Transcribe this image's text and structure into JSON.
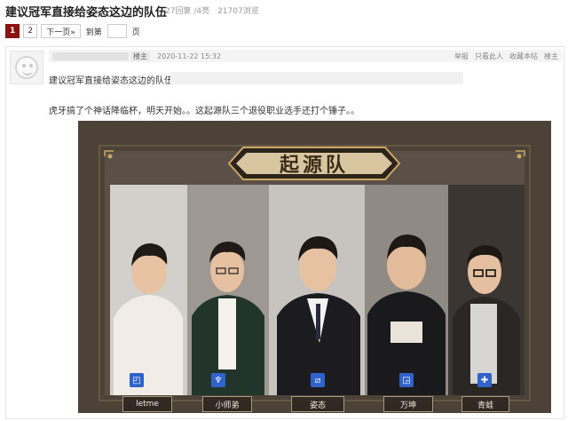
{
  "thread": {
    "title": "建议冠军直接给姿态这边的队伍",
    "stats": "27回复 /4亮　21707浏览"
  },
  "pager": {
    "pages": [
      "1",
      "2"
    ],
    "next_label": "下一页»",
    "goto_label": "到第",
    "page_unit": "页"
  },
  "post": {
    "floor": "楼主",
    "date": "2020-11-22 15:32",
    "actions": [
      "举报",
      "只看此人",
      "收藏本帖",
      "楼主"
    ],
    "title": "建议冠军直接给姿态这边的队伍",
    "body": "虎牙搞了个神话降临杯，明天开始。。这起源队三个退役职业选手还打个锤子。。"
  },
  "banner": {
    "team_name": "起源队",
    "players": [
      {
        "name": "letme",
        "role_icon": "top-lane-icon"
      },
      {
        "name": "小师弟",
        "role_icon": "jungle-icon"
      },
      {
        "name": "姿态",
        "role_icon": "mid-lane-icon"
      },
      {
        "name": "万坤",
        "role_icon": "bot-lane-icon"
      },
      {
        "name": "青蛙",
        "role_icon": "support-icon"
      }
    ],
    "colors": {
      "background": "#4c4238",
      "gold": "#c9a866",
      "plate": "#2e261e",
      "role_blue": "#2f63c9"
    }
  }
}
